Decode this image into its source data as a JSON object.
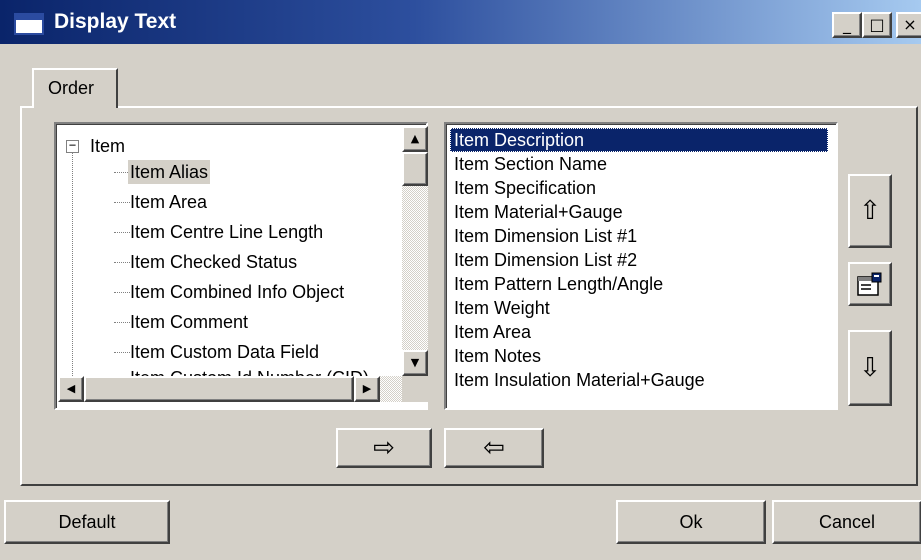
{
  "window": {
    "title": "Display Text",
    "minimize_glyph": "_",
    "maximize_glyph": "□",
    "close_glyph": "×"
  },
  "tabs": [
    {
      "label": "Order",
      "active": true
    }
  ],
  "tree": {
    "root_label": "Item",
    "expand_glyph": "−",
    "selected": "Item Alias",
    "children": [
      "Item Alias",
      "Item Area",
      "Item Centre Line Length",
      "Item Checked Status",
      "Item Combined Info Object",
      "Item Comment",
      "Item Custom Data Field",
      "Item Custom Id Number (CID)"
    ]
  },
  "display_list": {
    "selected": "Item Description",
    "items": [
      "Item Description",
      "Item Section Name",
      "Item Specification",
      "Item Material+Gauge",
      "Item Dimension List #1",
      "Item Dimension List #2",
      "Item Pattern Length/Angle",
      "Item Weight",
      "Item Area",
      "Item Notes",
      "Item Insulation Material+Gauge"
    ]
  },
  "buttons": {
    "move_up_glyph": "⇧",
    "move_down_glyph": "⇩",
    "add_glyph": "⇨",
    "remove_glyph": "⇦",
    "default": "Default",
    "ok": "Ok",
    "cancel": "Cancel"
  },
  "scroll": {
    "up": "▲",
    "down": "▼",
    "left": "◀",
    "right": "▶"
  },
  "colors": {
    "selection": "#0a246a",
    "face": "#d4d0c8",
    "titlebar_start": "#0a246a",
    "titlebar_end": "#a6caf0"
  }
}
